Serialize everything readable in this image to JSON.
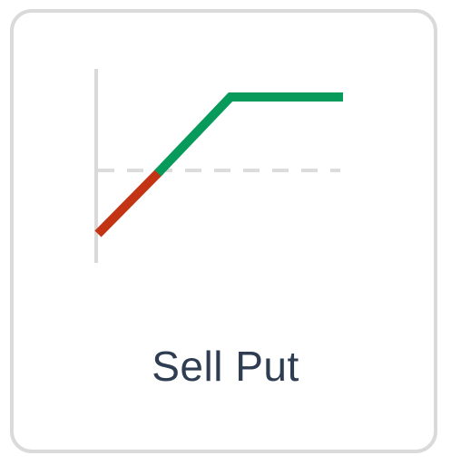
{
  "card": {
    "label": "Sell Put"
  },
  "icon": {
    "name": "sell-put-payoff-icon",
    "axis_color": "#d9d9d9",
    "breakeven_line_color": "#dcdcdc",
    "loss_color": "#c23414",
    "profit_color": "#089a5a"
  },
  "text_color": "#2f3d52",
  "border_color": "#dadada"
}
